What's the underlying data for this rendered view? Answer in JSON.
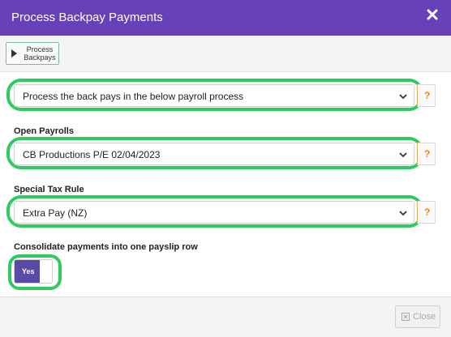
{
  "dialog": {
    "title": "Process Backpay Payments"
  },
  "toolbar": {
    "process_backpays_label": "Process Backpays",
    "process_backpays_icon": "play-icon"
  },
  "fields": {
    "process_mode": {
      "label": "",
      "value": "Process the back pays in the below payroll process",
      "help": "?"
    },
    "open_payrolls": {
      "label": "Open Payrolls",
      "value": "CB Productions P/E 02/04/2023",
      "help": "?"
    },
    "special_tax_rule": {
      "label": "Special Tax Rule",
      "value": "Extra Pay (NZ)",
      "help": "?"
    },
    "consolidate": {
      "label": "Consolidate payments into one payslip row",
      "toggle_value": "Yes"
    }
  },
  "footer": {
    "close_label": "Close"
  },
  "colors": {
    "header_bg": "#6741b8",
    "highlight_ring": "#2ecc60",
    "toggle_on": "#5a4aa6",
    "help_accent": "#e08a1e"
  }
}
